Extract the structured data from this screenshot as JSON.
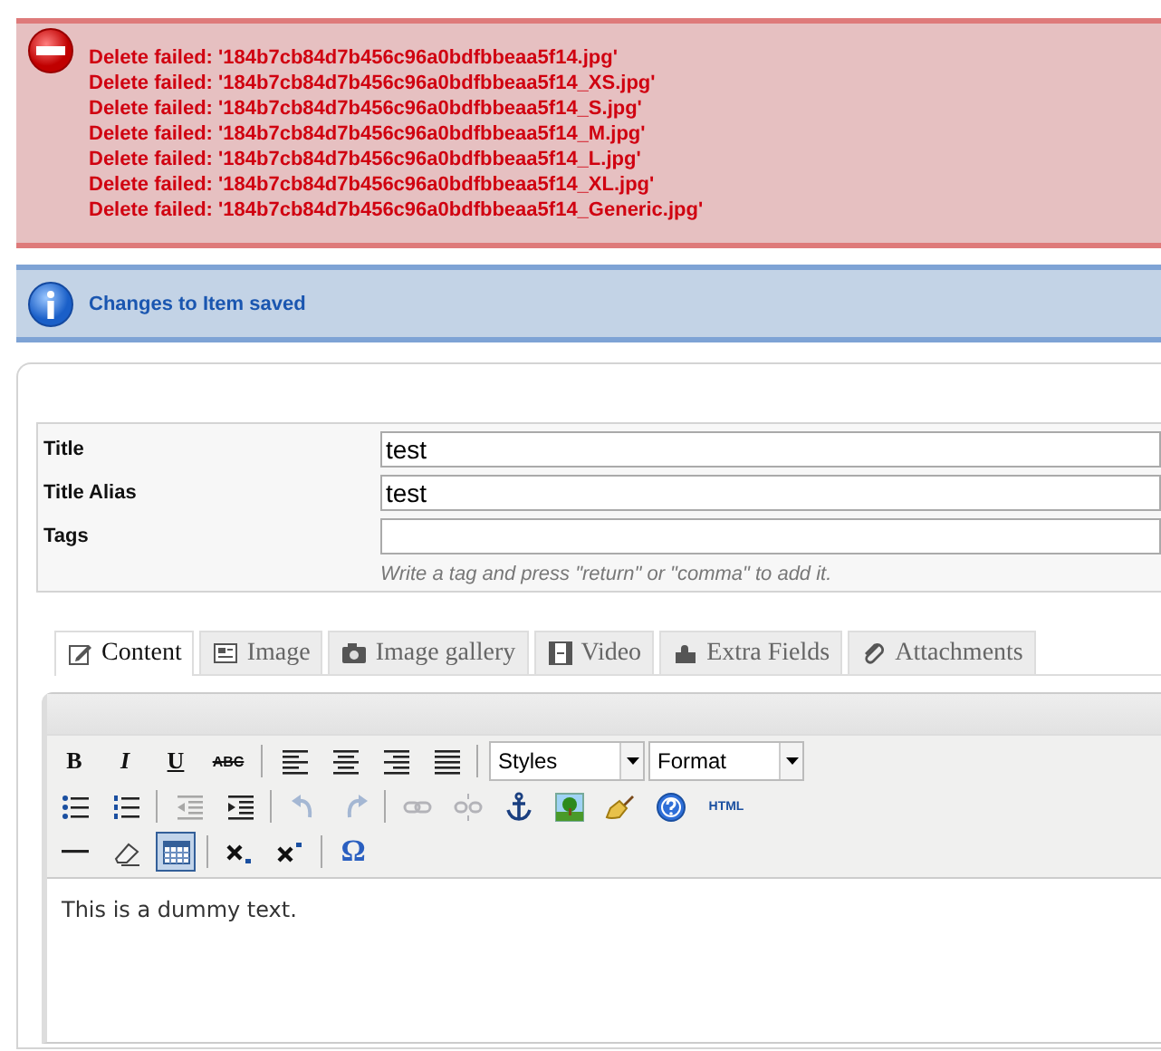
{
  "messages": [
    {
      "kind": "error",
      "lines": [
        "Delete failed: '184b7cb84d7b456c96a0bdfbbeaa5f14.jpg'",
        "Delete failed: '184b7cb84d7b456c96a0bdfbbeaa5f14_XS.jpg'",
        "Delete failed: '184b7cb84d7b456c96a0bdfbbeaa5f14_S.jpg'",
        "Delete failed: '184b7cb84d7b456c96a0bdfbbeaa5f14_M.jpg'",
        "Delete failed: '184b7cb84d7b456c96a0bdfbbeaa5f14_L.jpg'",
        "Delete failed: '184b7cb84d7b456c96a0bdfbbeaa5f14_XL.jpg'",
        "Delete failed: '184b7cb84d7b456c96a0bdfbbeaa5f14_Generic.jpg'"
      ]
    },
    {
      "kind": "info",
      "lines": [
        "Changes to Item saved"
      ]
    }
  ],
  "form": {
    "fields": [
      {
        "label": "Title",
        "value": "test"
      },
      {
        "label": "Title Alias",
        "value": "test"
      },
      {
        "label": "Tags",
        "hint": "Write a tag and press \"return\" or \"comma\" to add it."
      }
    ]
  },
  "tabs": [
    {
      "label": "Content",
      "selected": true
    },
    {
      "label": "Image",
      "selected": false
    },
    {
      "label": "Image gallery",
      "selected": false
    },
    {
      "label": "Video",
      "selected": false
    },
    {
      "label": "Extra Fields",
      "selected": false
    },
    {
      "label": "Attachments",
      "selected": false
    }
  ],
  "toolbar": {
    "rows": [
      [
        {
          "kind": "bold",
          "label": "B",
          "disabled": false,
          "active": false
        },
        {
          "kind": "italic",
          "label": "I",
          "disabled": false,
          "active": false
        },
        {
          "kind": "underline",
          "label": "U",
          "disabled": false,
          "active": false
        },
        {
          "kind": "strike",
          "label": "ABC",
          "disabled": false,
          "active": false
        },
        {
          "kind": "sep"
        },
        {
          "kind": "align-left",
          "disabled": false,
          "active": false
        },
        {
          "kind": "align-center",
          "disabled": false,
          "active": false
        },
        {
          "kind": "align-right",
          "disabled": false,
          "active": false
        },
        {
          "kind": "justify",
          "disabled": false,
          "active": false
        },
        {
          "kind": "sep"
        },
        {
          "kind": "select",
          "value": "Styles"
        },
        {
          "kind": "select",
          "value": "Format"
        }
      ],
      [
        {
          "kind": "bullets",
          "disabled": false,
          "active": false
        },
        {
          "kind": "numbers",
          "disabled": false,
          "active": false
        },
        {
          "kind": "sep"
        },
        {
          "kind": "outdent",
          "disabled": true,
          "active": false
        },
        {
          "kind": "indent",
          "disabled": false,
          "active": false
        },
        {
          "kind": "sep"
        },
        {
          "kind": "undo",
          "disabled": true,
          "active": false
        },
        {
          "kind": "redo",
          "disabled": true,
          "active": false
        },
        {
          "kind": "sep"
        },
        {
          "kind": "link",
          "disabled": true,
          "active": false
        },
        {
          "kind": "unlink",
          "disabled": true,
          "active": false
        },
        {
          "kind": "anchor",
          "disabled": false,
          "active": false
        },
        {
          "kind": "picture",
          "disabled": false,
          "active": false
        },
        {
          "kind": "brush",
          "disabled": false,
          "active": false
        },
        {
          "kind": "help",
          "disabled": false,
          "active": false
        },
        {
          "kind": "html",
          "label": "HTML",
          "disabled": false,
          "active": false
        }
      ],
      [
        {
          "kind": "hr",
          "disabled": false,
          "active": false
        },
        {
          "kind": "eraser",
          "disabled": false,
          "active": false
        },
        {
          "kind": "table",
          "disabled": false,
          "active": true
        },
        {
          "kind": "sep"
        },
        {
          "kind": "subscript",
          "disabled": false,
          "active": false
        },
        {
          "kind": "superscript",
          "disabled": false,
          "active": false
        },
        {
          "kind": "sep"
        },
        {
          "kind": "omega",
          "label": "Ω",
          "disabled": false,
          "active": false
        }
      ]
    ]
  },
  "editor": {
    "text": "This is a dummy text."
  }
}
